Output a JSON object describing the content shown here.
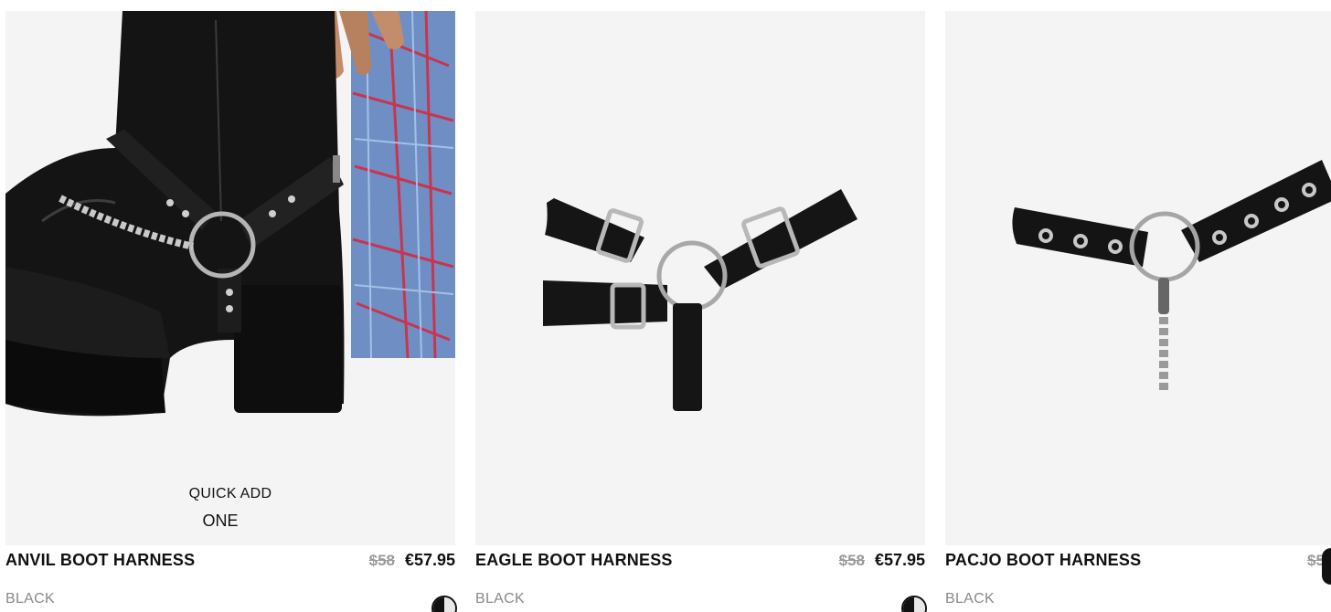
{
  "products": [
    {
      "name": "ANVIL BOOT HARNESS",
      "original_price": "$58",
      "price": "€57.95",
      "color": "BLACK",
      "quick_add_label": "QUICK ADD",
      "size_option": "ONE",
      "image": "boot-with-harness-photo"
    },
    {
      "name": "EAGLE BOOT HARNESS",
      "original_price": "$58",
      "price": "€57.95",
      "color": "BLACK",
      "image": "triple-buckle-harness-photo"
    },
    {
      "name": "PACJO BOOT HARNESS",
      "original_price": "$5",
      "price": "",
      "color": "BLACK",
      "image": "studded-chain-harness-photo"
    }
  ],
  "colors": {
    "background": "#ffffff",
    "image_bg": "#f4f4f5",
    "text": "#111111",
    "muted": "#8a8a8a",
    "strike": "#9a9a9a"
  }
}
